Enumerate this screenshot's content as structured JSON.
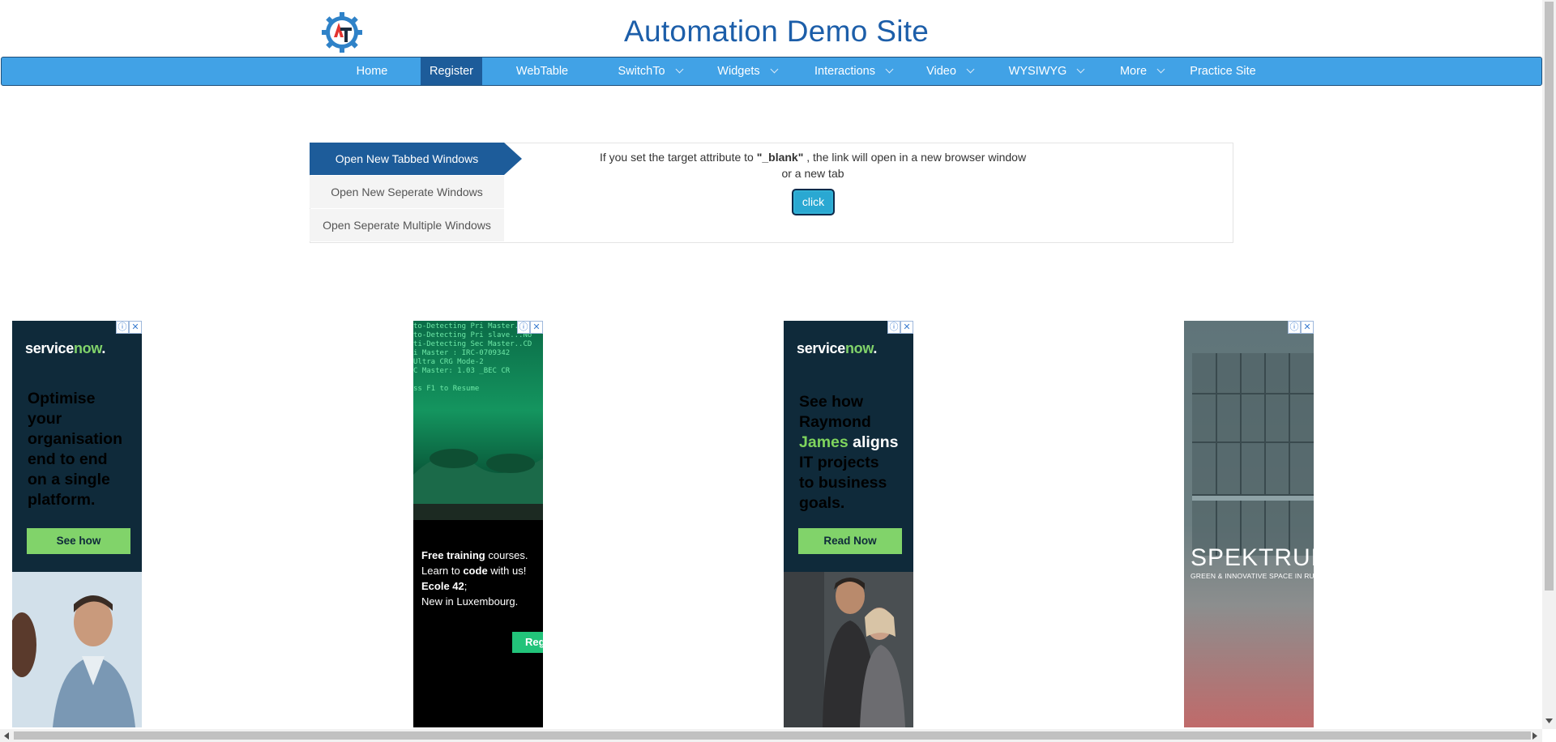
{
  "header": {
    "title": "Automation Demo Site",
    "logo_icon": "gear-logo-icon"
  },
  "nav": {
    "items": [
      {
        "label": "Home",
        "dropdown": false,
        "active": false
      },
      {
        "label": "Register",
        "dropdown": false,
        "active": true
      },
      {
        "label": "WebTable",
        "dropdown": false,
        "active": false
      },
      {
        "label": "SwitchTo",
        "dropdown": true,
        "active": false
      },
      {
        "label": "Widgets",
        "dropdown": true,
        "active": false
      },
      {
        "label": "Interactions",
        "dropdown": true,
        "active": false
      },
      {
        "label": "Video",
        "dropdown": true,
        "active": false
      },
      {
        "label": "WYSIWYG",
        "dropdown": true,
        "active": false
      },
      {
        "label": "More",
        "dropdown": true,
        "active": false
      },
      {
        "label": "Practice Site",
        "dropdown": false,
        "active": false
      }
    ]
  },
  "tabs": [
    {
      "label": "Open New Tabbed Windows",
      "active": true
    },
    {
      "label": "Open New Seperate Windows",
      "active": false
    },
    {
      "label": "Open Seperate Multiple Windows",
      "active": false
    }
  ],
  "content": {
    "desc_before": "If you set the target attribute to ",
    "desc_bold": "\"_blank\"",
    "desc_after": " , the link will open in a new browser window",
    "desc_line2": "or a new tab",
    "button_label": "click"
  },
  "ads": {
    "ad1": {
      "brand": "service",
      "brand_accent": "now",
      "brand_suffix": ".",
      "line1": "Optimise",
      "line2": "your",
      "line3": "organisation",
      "line4": "end to end",
      "line5": "on a single",
      "line6": "platform.",
      "button": "See how"
    },
    "ad2": {
      "code": [
        "to-Detecting Pri Master..",
        "to-Detecting Pri slave...No",
        "ti-Detecting Sec Master..CD",
        "i Master : IRC-0709342",
        "        Ultra CRG Mode-2",
        "C Master: 1.03         _BEC CR",
        "",
        "ss F1 to Resume"
      ],
      "text_bold1": "Free training",
      "text1": " courses.",
      "text2": "Learn to ",
      "text_bold2": "code",
      "text3": " with us!",
      "text_bold3": "Ecole 42",
      "text4": "New in Luxembourg.",
      "button": "Reg"
    },
    "ad3": {
      "brand": "service",
      "brand_accent": "now",
      "brand_suffix": ".",
      "line1": "See how",
      "line2": "Raymond",
      "line3_green": "James",
      "line3_white": " aligns",
      "line4": "IT projects",
      "line5": "to business",
      "line6": "goals.",
      "button": "Read Now"
    },
    "ad4": {
      "brand": "SPEKTRUM",
      "sub": "GREEN & INNOVATIVE SPACE IN RUMELANGE"
    },
    "info_icon": "ⓘ",
    "close_icon": "✕"
  },
  "colors": {
    "nav_bg": "#41a2e6",
    "nav_active": "#1d5c9a",
    "title": "#1c5ea9",
    "button": "#31b0d5"
  }
}
